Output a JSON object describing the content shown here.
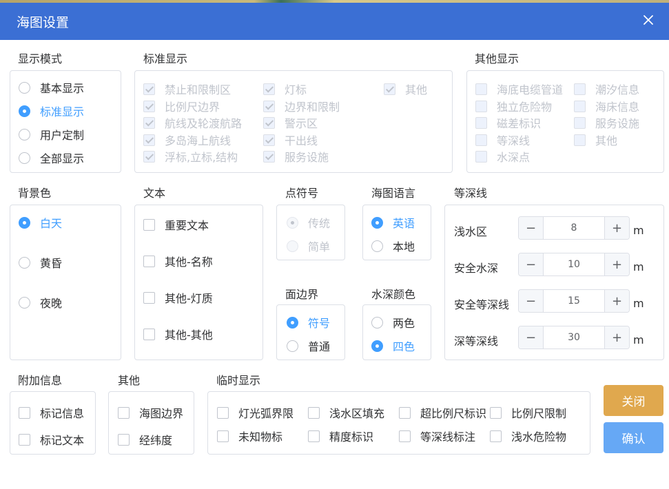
{
  "dialog": {
    "title": "海图设置"
  },
  "display_mode": {
    "title": "显示模式",
    "options": [
      "基本显示",
      "标准显示",
      "用户定制",
      "全部显示"
    ]
  },
  "standard_display": {
    "title": "标准显示",
    "items": [
      "禁止和限制区",
      "比例尺边界",
      "航线及轮渡航路",
      "多岛海上航线",
      "浮标,立标,结构",
      "灯标",
      "边界和限制",
      "警示区",
      "干出线",
      "服务设施",
      "其他"
    ]
  },
  "other_display": {
    "title": "其他显示",
    "items": [
      "海底电缆管道",
      "独立危险物",
      "磁差标识",
      "等深线",
      "水深点",
      "潮汐信息",
      "海床信息",
      "服务设施",
      "其他"
    ]
  },
  "background": {
    "title": "背景色",
    "options": [
      "白天",
      "黄昏",
      "夜晚"
    ]
  },
  "text": {
    "title": "文本",
    "items": [
      "重要文本",
      "其他-名称",
      "其他-灯质",
      "其他-其他"
    ]
  },
  "point_symbol": {
    "title": "点符号",
    "options": [
      "传统",
      "简单"
    ]
  },
  "chart_language": {
    "title": "海图语言",
    "options": [
      "英语",
      "本地"
    ]
  },
  "area_boundary": {
    "title": "面边界",
    "options": [
      "符号",
      "普通"
    ]
  },
  "depth_color": {
    "title": "水深颜色",
    "options": [
      "两色",
      "四色"
    ]
  },
  "depth_contour": {
    "title": "等深线",
    "rows": [
      {
        "label": "浅水区",
        "value": "8",
        "unit": "m"
      },
      {
        "label": "安全水深",
        "value": "10",
        "unit": "m"
      },
      {
        "label": "安全等深线",
        "value": "15",
        "unit": "m"
      },
      {
        "label": "深等深线",
        "value": "30",
        "unit": "m"
      }
    ],
    "minus": "−",
    "plus": "+"
  },
  "additional_info": {
    "title": "附加信息",
    "items": [
      "标记信息",
      "标记文本"
    ]
  },
  "others": {
    "title": "其他",
    "items": [
      "海图边界",
      "经纬度"
    ]
  },
  "temp_display": {
    "title": "临时显示",
    "items": [
      "灯光弧界限",
      "浅水区填充",
      "超比例尺标识",
      "比例尺限制",
      "未知物标",
      "精度标识",
      "等深线标注",
      "浅水危险物"
    ]
  },
  "buttons": {
    "close": "关闭",
    "confirm": "确认"
  },
  "colors": {
    "header": "#3b6fd4",
    "accent": "#409eff",
    "close_button": "#e0a84e",
    "confirm_button": "#66a8f5"
  }
}
